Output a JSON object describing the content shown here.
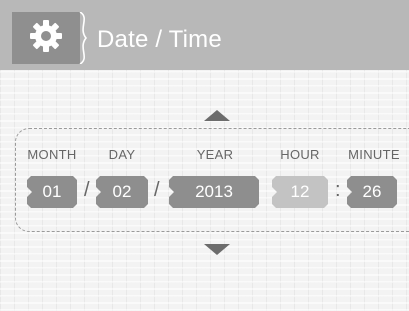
{
  "header": {
    "title": "Date / Time",
    "icon": "gear-icon",
    "colors": {
      "bar": "#b8b8b8",
      "tab": "#8f8f8f"
    }
  },
  "labels": {
    "month": "MONTH",
    "day": "DAY",
    "year": "YEAR",
    "hour": "HOUR",
    "minute": "MINUTE"
  },
  "values": {
    "month": "01",
    "day": "02",
    "year": "2013",
    "hour": "12",
    "minute": "26"
  },
  "separators": {
    "date1": "/",
    "date2": "/",
    "time": ":"
  },
  "colors": {
    "field": "#8e8e8e",
    "field_dim": "#c3c3c3",
    "arrow": "#6c6c6c"
  }
}
